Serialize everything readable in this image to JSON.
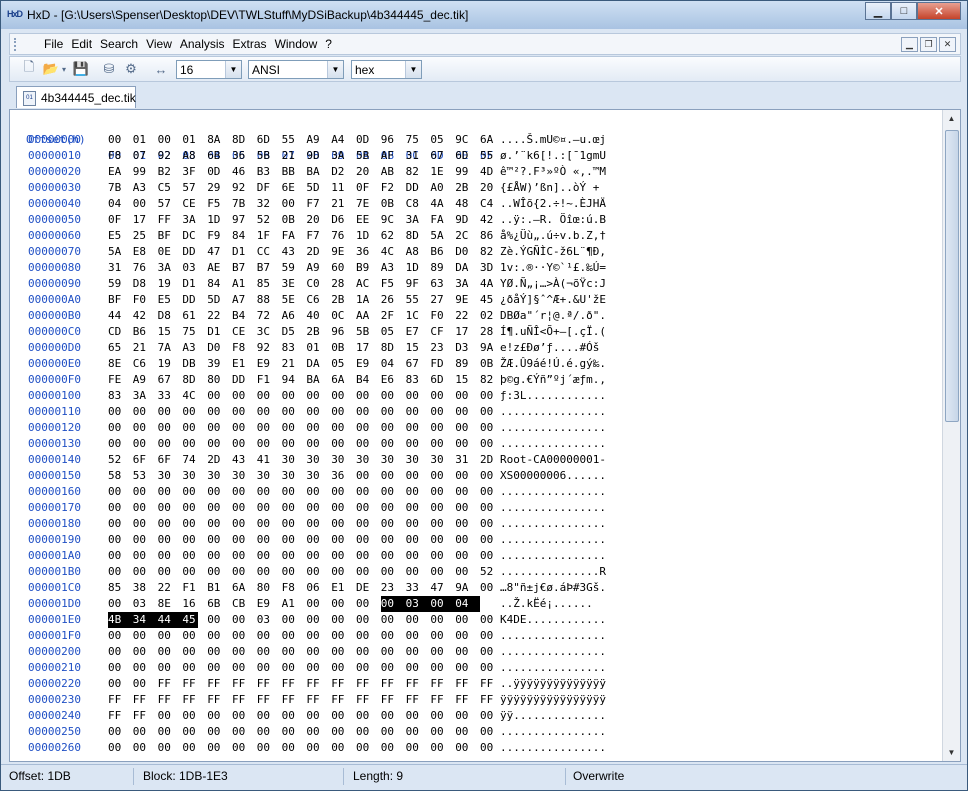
{
  "window": {
    "title": "HxD - [G:\\Users\\Spenser\\Desktop\\DEV\\TWLStuff\\MyDSiBackup\\4b344445_dec.tik]",
    "app_icon_text": "HxD"
  },
  "menu": [
    "File",
    "Edit",
    "Search",
    "View",
    "Analysis",
    "Extras",
    "Window",
    "?"
  ],
  "toolbar": {
    "bytes_per_row": "16",
    "charset": "ANSI",
    "offset_base": "hex"
  },
  "tab": {
    "label": "4b344445_dec.tik"
  },
  "header": {
    "offset_label": "Offset(h)",
    "columns": [
      "00",
      "01",
      "02",
      "03",
      "04",
      "05",
      "06",
      "07",
      "08",
      "09",
      "0A",
      "0B",
      "0C",
      "0D",
      "0E",
      "0F"
    ]
  },
  "rows": [
    {
      "o": "00000000",
      "h": [
        "00",
        "01",
        "00",
        "01",
        "8A",
        "8D",
        "6D",
        "55",
        "A9",
        "A4",
        "0D",
        "96",
        "75",
        "05",
        "9C",
        "6A"
      ],
      "a": "....Š.mU©¤.–u.œj"
    },
    {
      "o": "00000010",
      "h": [
        "F8",
        "07",
        "92",
        "A8",
        "6B",
        "36",
        "5B",
        "21",
        "9D",
        "3A",
        "5B",
        "AF",
        "31",
        "67",
        "6D",
        "55"
      ],
      "a": "ø.’¨k6[!.:[¯1gmU"
    },
    {
      "o": "00000020",
      "h": [
        "EA",
        "99",
        "B2",
        "3F",
        "0D",
        "46",
        "B3",
        "BB",
        "BA",
        "D2",
        "20",
        "AB",
        "82",
        "1E",
        "99",
        "4D"
      ],
      "a": "ê™²?.F³»ºÒ «‚.™M"
    },
    {
      "o": "00000030",
      "h": [
        "7B",
        "A3",
        "C5",
        "57",
        "29",
        "92",
        "DF",
        "6E",
        "5D",
        "11",
        "0F",
        "F2",
        "DD",
        "A0",
        "2B",
        "20"
      ],
      "a": "{£ÅW)’ßn]..òÝ + "
    },
    {
      "o": "00000040",
      "h": [
        "04",
        "00",
        "57",
        "CE",
        "F5",
        "7B",
        "32",
        "00",
        "F7",
        "21",
        "7E",
        "0B",
        "C8",
        "4A",
        "48",
        "C4"
      ],
      "a": "..WÎõ{2.÷!~.ÈJHÄ"
    },
    {
      "o": "00000050",
      "h": [
        "0F",
        "17",
        "FF",
        "3A",
        "1D",
        "97",
        "52",
        "0B",
        "20",
        "D6",
        "EE",
        "9C",
        "3A",
        "FA",
        "9D",
        "42"
      ],
      "a": "..ÿ:.—R. Öîœ:ú.B"
    },
    {
      "o": "00000060",
      "h": [
        "E5",
        "25",
        "BF",
        "DC",
        "F9",
        "84",
        "1F",
        "FA",
        "F7",
        "76",
        "1D",
        "62",
        "8D",
        "5A",
        "2C",
        "86"
      ],
      "a": "å%¿Üù„.ú÷v.b.Z,†"
    },
    {
      "o": "00000070",
      "h": [
        "5A",
        "E8",
        "0E",
        "DD",
        "47",
        "D1",
        "CC",
        "43",
        "2D",
        "9E",
        "36",
        "4C",
        "A8",
        "B6",
        "D0",
        "82"
      ],
      "a": "Zè.ÝGÑÌC-ž6L¨¶Ð‚"
    },
    {
      "o": "00000080",
      "h": [
        "31",
        "76",
        "3A",
        "03",
        "AE",
        "B7",
        "B7",
        "59",
        "A9",
        "60",
        "B9",
        "A3",
        "1D",
        "89",
        "DA",
        "3D"
      ],
      "a": "1v:.®··Y©`¹£.‰Ú="
    },
    {
      "o": "00000090",
      "h": [
        "59",
        "D8",
        "19",
        "D1",
        "84",
        "A1",
        "85",
        "3E",
        "C0",
        "28",
        "AC",
        "F5",
        "9F",
        "63",
        "3A",
        "4A"
      ],
      "a": "YØ.Ñ„¡…>À(¬õŸc:J"
    },
    {
      "o": "000000A0",
      "h": [
        "BF",
        "F0",
        "E5",
        "DD",
        "5D",
        "A7",
        "88",
        "5E",
        "C6",
        "2B",
        "1A",
        "26",
        "55",
        "27",
        "9E",
        "45"
      ],
      "a": "¿ðåÝ]§ˆ^Æ+.&U'žE"
    },
    {
      "o": "000000B0",
      "h": [
        "44",
        "42",
        "D8",
        "61",
        "22",
        "B4",
        "72",
        "A6",
        "40",
        "0C",
        "AA",
        "2F",
        "1C",
        "F0",
        "22",
        "02"
      ],
      "a": "DBØa\"´r¦@.ª/.ð\"."
    },
    {
      "o": "000000C0",
      "h": [
        "CD",
        "B6",
        "15",
        "75",
        "D1",
        "CE",
        "3C",
        "D5",
        "2B",
        "96",
        "5B",
        "05",
        "E7",
        "CF",
        "17",
        "28"
      ],
      "a": "Í¶.uÑÎ<Õ+–[.çÏ.("
    },
    {
      "o": "000000D0",
      "h": [
        "65",
        "21",
        "7A",
        "A3",
        "D0",
        "F8",
        "92",
        "83",
        "01",
        "0B",
        "17",
        "8D",
        "15",
        "23",
        "D3",
        "9A"
      ],
      "a": "e!z£Ðø’ƒ....#Óš"
    },
    {
      "o": "000000E0",
      "h": [
        "8E",
        "C6",
        "19",
        "DB",
        "39",
        "E1",
        "E9",
        "21",
        "DA",
        "05",
        "E9",
        "04",
        "67",
        "FD",
        "89",
        "0B"
      ],
      "a": "ŽÆ.Û9áé!Ú.é.gý‰."
    },
    {
      "o": "000000F0",
      "h": [
        "FE",
        "A9",
        "67",
        "8D",
        "80",
        "DD",
        "F1",
        "94",
        "BA",
        "6A",
        "B4",
        "E6",
        "83",
        "6D",
        "15",
        "82"
      ],
      "a": "þ©g.€Ýñ”ºj´æƒm.‚"
    },
    {
      "o": "00000100",
      "h": [
        "83",
        "3A",
        "33",
        "4C",
        "00",
        "00",
        "00",
        "00",
        "00",
        "00",
        "00",
        "00",
        "00",
        "00",
        "00",
        "00"
      ],
      "a": "ƒ:3L............"
    },
    {
      "o": "00000110",
      "h": [
        "00",
        "00",
        "00",
        "00",
        "00",
        "00",
        "00",
        "00",
        "00",
        "00",
        "00",
        "00",
        "00",
        "00",
        "00",
        "00"
      ],
      "a": "................"
    },
    {
      "o": "00000120",
      "h": [
        "00",
        "00",
        "00",
        "00",
        "00",
        "00",
        "00",
        "00",
        "00",
        "00",
        "00",
        "00",
        "00",
        "00",
        "00",
        "00"
      ],
      "a": "................"
    },
    {
      "o": "00000130",
      "h": [
        "00",
        "00",
        "00",
        "00",
        "00",
        "00",
        "00",
        "00",
        "00",
        "00",
        "00",
        "00",
        "00",
        "00",
        "00",
        "00"
      ],
      "a": "................"
    },
    {
      "o": "00000140",
      "h": [
        "52",
        "6F",
        "6F",
        "74",
        "2D",
        "43",
        "41",
        "30",
        "30",
        "30",
        "30",
        "30",
        "30",
        "30",
        "31",
        "2D"
      ],
      "a": "Root-CA00000001-"
    },
    {
      "o": "00000150",
      "h": [
        "58",
        "53",
        "30",
        "30",
        "30",
        "30",
        "30",
        "30",
        "30",
        "36",
        "00",
        "00",
        "00",
        "00",
        "00",
        "00"
      ],
      "a": "XS00000006......"
    },
    {
      "o": "00000160",
      "h": [
        "00",
        "00",
        "00",
        "00",
        "00",
        "00",
        "00",
        "00",
        "00",
        "00",
        "00",
        "00",
        "00",
        "00",
        "00",
        "00"
      ],
      "a": "................"
    },
    {
      "o": "00000170",
      "h": [
        "00",
        "00",
        "00",
        "00",
        "00",
        "00",
        "00",
        "00",
        "00",
        "00",
        "00",
        "00",
        "00",
        "00",
        "00",
        "00"
      ],
      "a": "................"
    },
    {
      "o": "00000180",
      "h": [
        "00",
        "00",
        "00",
        "00",
        "00",
        "00",
        "00",
        "00",
        "00",
        "00",
        "00",
        "00",
        "00",
        "00",
        "00",
        "00"
      ],
      "a": "................"
    },
    {
      "o": "00000190",
      "h": [
        "00",
        "00",
        "00",
        "00",
        "00",
        "00",
        "00",
        "00",
        "00",
        "00",
        "00",
        "00",
        "00",
        "00",
        "00",
        "00"
      ],
      "a": "................"
    },
    {
      "o": "000001A0",
      "h": [
        "00",
        "00",
        "00",
        "00",
        "00",
        "00",
        "00",
        "00",
        "00",
        "00",
        "00",
        "00",
        "00",
        "00",
        "00",
        "00"
      ],
      "a": "................"
    },
    {
      "o": "000001B0",
      "h": [
        "00",
        "00",
        "00",
        "00",
        "00",
        "00",
        "00",
        "00",
        "00",
        "00",
        "00",
        "00",
        "00",
        "00",
        "00",
        "52"
      ],
      "a": "...............R"
    },
    {
      "o": "000001C0",
      "h": [
        "85",
        "38",
        "22",
        "F1",
        "B1",
        "6A",
        "80",
        "F8",
        "06",
        "E1",
        "DE",
        "23",
        "33",
        "47",
        "9A",
        "00"
      ],
      "a": "…8\"ñ±j€ø.áÞ#3Gš."
    },
    {
      "o": "000001D0",
      "h": [
        "00",
        "03",
        "8E",
        "16",
        "6B",
        "CB",
        "E9",
        "A1",
        "00",
        "00",
        "00",
        "00",
        "03",
        "00",
        "04"
      ],
      "a": "..Ž.kËé¡......"
    },
    {
      "o": "000001E0",
      "h": [
        "4B",
        "34",
        "44",
        "45",
        "00",
        "00",
        "03",
        "00",
        "00",
        "00",
        "00",
        "00",
        "00",
        "00",
        "00",
        "00"
      ],
      "a": "K4DE............"
    },
    {
      "o": "000001F0",
      "h": [
        "00",
        "00",
        "00",
        "00",
        "00",
        "00",
        "00",
        "00",
        "00",
        "00",
        "00",
        "00",
        "00",
        "00",
        "00",
        "00"
      ],
      "a": "................"
    },
    {
      "o": "00000200",
      "h": [
        "00",
        "00",
        "00",
        "00",
        "00",
        "00",
        "00",
        "00",
        "00",
        "00",
        "00",
        "00",
        "00",
        "00",
        "00",
        "00"
      ],
      "a": "................"
    },
    {
      "o": "00000210",
      "h": [
        "00",
        "00",
        "00",
        "00",
        "00",
        "00",
        "00",
        "00",
        "00",
        "00",
        "00",
        "00",
        "00",
        "00",
        "00",
        "00"
      ],
      "a": "................"
    },
    {
      "o": "00000220",
      "h": [
        "00",
        "00",
        "FF",
        "FF",
        "FF",
        "FF",
        "FF",
        "FF",
        "FF",
        "FF",
        "FF",
        "FF",
        "FF",
        "FF",
        "FF",
        "FF"
      ],
      "a": "..ÿÿÿÿÿÿÿÿÿÿÿÿÿÿ"
    },
    {
      "o": "00000230",
      "h": [
        "FF",
        "FF",
        "FF",
        "FF",
        "FF",
        "FF",
        "FF",
        "FF",
        "FF",
        "FF",
        "FF",
        "FF",
        "FF",
        "FF",
        "FF",
        "FF"
      ],
      "a": "ÿÿÿÿÿÿÿÿÿÿÿÿÿÿÿÿ"
    },
    {
      "o": "00000240",
      "h": [
        "FF",
        "FF",
        "00",
        "00",
        "00",
        "00",
        "00",
        "00",
        "00",
        "00",
        "00",
        "00",
        "00",
        "00",
        "00",
        "00"
      ],
      "a": "ÿÿ.............."
    },
    {
      "o": "00000250",
      "h": [
        "00",
        "00",
        "00",
        "00",
        "00",
        "00",
        "00",
        "00",
        "00",
        "00",
        "00",
        "00",
        "00",
        "00",
        "00",
        "00"
      ],
      "a": "................"
    },
    {
      "o": "00000260",
      "h": [
        "00",
        "00",
        "00",
        "00",
        "00",
        "00",
        "00",
        "00",
        "00",
        "00",
        "00",
        "00",
        "00",
        "00",
        "00",
        "00"
      ],
      "a": "................"
    }
  ],
  "selection": {
    "hex_start_index": 475,
    "hex_end_index": 483
  },
  "status": {
    "offset": "Offset: 1DB",
    "block": "Block: 1DB-1E3",
    "length": "Length: 9",
    "mode": "Overwrite"
  }
}
